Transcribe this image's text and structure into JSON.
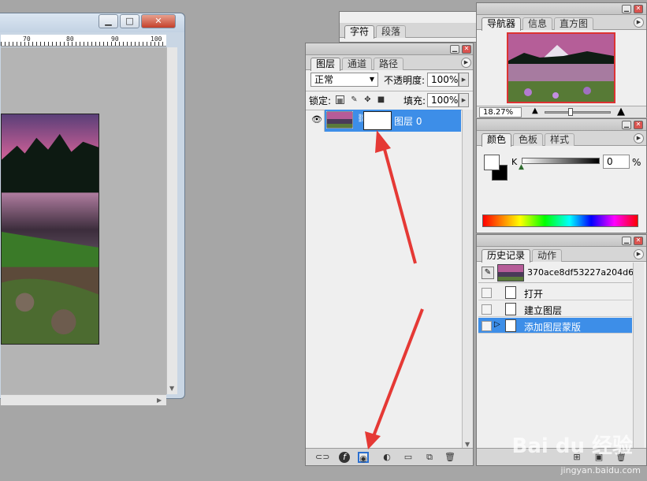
{
  "document": {
    "ruler_labels": [
      "70",
      "80",
      "90",
      "100"
    ]
  },
  "layers_panel": {
    "tabs": [
      "图层",
      "通道",
      "路径"
    ],
    "blend_mode": "正常",
    "opacity_label": "不透明度:",
    "opacity_value": "100%",
    "lock_label": "锁定:",
    "fill_label": "填充:",
    "fill_value": "100%",
    "layer_name": "图层 0"
  },
  "char_panel": {
    "tabs": [
      "字符",
      "段落"
    ]
  },
  "navigator_panel": {
    "tabs": [
      "导航器",
      "信息",
      "直方图"
    ],
    "zoom": "18.27%"
  },
  "color_panel": {
    "tabs": [
      "颜色",
      "色板",
      "样式"
    ],
    "channel_label": "K",
    "channel_value": "0",
    "channel_unit": "%"
  },
  "history_panel": {
    "tabs": [
      "历史记录",
      "动作"
    ],
    "snapshot_name": "370ace8df53227a204d6...",
    "items": [
      "打开",
      "建立图层",
      "添加图层蒙版"
    ]
  },
  "watermark": {
    "brand": "Bai du 经验",
    "url": "jingyan.baidu.com"
  },
  "colors": {
    "selection": "#3d8ee8",
    "annotation": "#e53935"
  }
}
